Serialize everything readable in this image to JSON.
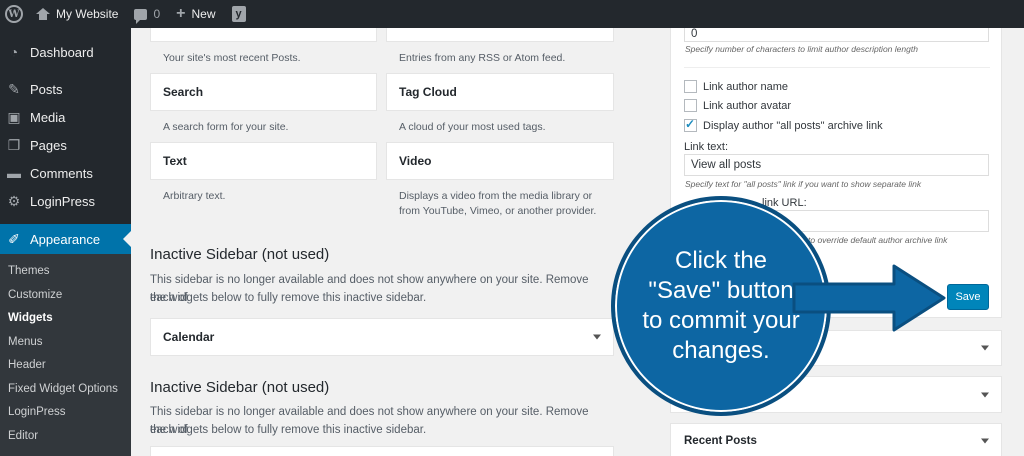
{
  "adminbar": {
    "site_name": "My Website",
    "comments_count": "0",
    "new_label": "New",
    "yoast_letter": "y"
  },
  "sidebar": {
    "items": [
      {
        "label": "Dashboard",
        "icon": "dashboard-icon"
      },
      {
        "label": "Posts",
        "icon": "pin-icon"
      },
      {
        "label": "Media",
        "icon": "media-icon"
      },
      {
        "label": "Pages",
        "icon": "pages-icon"
      },
      {
        "label": "Comments",
        "icon": "comments-icon"
      },
      {
        "label": "LoginPress",
        "icon": "gear-icon"
      }
    ],
    "active": {
      "label": "Appearance",
      "icon": "brush-icon"
    },
    "submenu": [
      "Themes",
      "Customize",
      "Widgets",
      "Menus",
      "Header",
      "Fixed Widget Options",
      "LoginPress",
      "Editor"
    ],
    "current_submenu": "Widgets"
  },
  "widgets": {
    "top_left_desc": "Your site's most recent Posts.",
    "top_right_desc": "Entries from any RSS or Atom feed.",
    "search": {
      "title": "Search",
      "desc": "A search form for your site."
    },
    "tag_cloud": {
      "title": "Tag Cloud",
      "desc": "A cloud of your most used tags."
    },
    "text": {
      "title": "Text",
      "desc": "Arbitrary text."
    },
    "video": {
      "title": "Video",
      "desc_line1": "Displays a video from the media library or",
      "desc_line2": "from YouTube, Vimeo, or another provider."
    }
  },
  "inactive_sidebars": [
    {
      "title": "Inactive Sidebar (not used)",
      "desc_line1": "This sidebar is no longer available and does not show anywhere on your site. Remove each of",
      "desc_line2": "the widgets below to fully remove this inactive sidebar.",
      "widget": "Calendar"
    },
    {
      "title": "Inactive Sidebar (not used)",
      "desc_line1": "This sidebar is no longer available and does not show anywhere on your site. Remove each of",
      "desc_line2": "the widgets below to fully remove this inactive sidebar."
    }
  ],
  "panel": {
    "char_limit_value": "0",
    "char_limit_hint": "Specify number of characters to limit author description length",
    "link_author_name": "Link author name",
    "link_author_avatar": "Link author avatar",
    "display_all_posts": "Display author \"all posts\" archive link",
    "link_text_label": "Link text:",
    "link_text_value": "View all posts",
    "link_text_hint": "Specify text for \"all posts\" link if you want to show separate link",
    "link_url_label_partial": "link URL:",
    "link_url_hint_partial": "to override default author archive link",
    "save_label": "Save",
    "recent_posts": "Recent Posts"
  },
  "callout": {
    "text_line1": "Click the",
    "text_line2": "\"Save\" button",
    "text_line3": "to commit your",
    "text_line4": "changes."
  },
  "colors": {
    "admin_dark": "#23282d",
    "accent_blue": "#0073aa",
    "callout_blue": "#0d66a3"
  }
}
